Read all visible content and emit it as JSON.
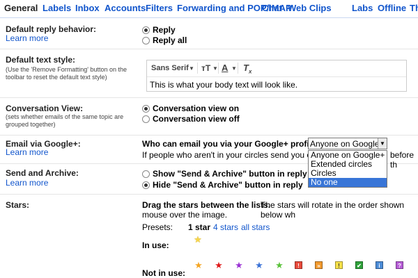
{
  "tabs": [
    "General",
    "Labels",
    "Inbox",
    "Accounts",
    "Filters",
    "Forwarding and POP/IMAP",
    "Chat",
    "Web Clips",
    "Labs",
    "Offline",
    "Th"
  ],
  "reply": {
    "label": "Default reply behavior:",
    "learn_more": "Learn more",
    "options": [
      "Reply",
      "Reply all"
    ],
    "selected": "Reply"
  },
  "text_style": {
    "label": "Default text style:",
    "hint": "(Use the 'Remove Formatting' button on the toolbar to reset the default text style)",
    "font": "Sans Serif",
    "size_icon": "text-size-icon",
    "color_icon": "text-color-icon",
    "remove_icon": "remove-formatting-icon",
    "sample": "This is what your body text will look like."
  },
  "conversation": {
    "label": "Conversation View:",
    "hint": "(sets whether emails of the same topic are grouped together)",
    "options": [
      "Conversation view on",
      "Conversation view off"
    ],
    "selected": "Conversation view on"
  },
  "google_plus": {
    "label": "Email via Google+:",
    "learn_more": "Learn more",
    "question": "Who can email you via your Google+ profile?",
    "selected": "Anyone on Google+",
    "options": [
      "Anyone on Google+",
      "Extended circles",
      "Circles",
      "No one"
    ],
    "highlighted": "No one",
    "note_start": "If people who aren't in your circles send you email t",
    "note_end": "before th"
  },
  "send_archive": {
    "label": "Send and Archive:",
    "learn_more": "Learn more",
    "options": [
      "Show \"Send & Archive\" button in reply",
      "Hide \"Send & Archive\" button in reply"
    ],
    "selected": "Hide \"Send & Archive\" button in reply"
  },
  "stars": {
    "label": "Stars:",
    "instructions_bold": "Drag the stars between the lists.",
    "instructions_rest": "The stars will rotate in the order shown below wh",
    "instructions_line2": "mouse over the image.",
    "presets_label": "Presets:",
    "presets": [
      "1 star",
      "4 stars",
      "all stars"
    ],
    "active_preset": "1 star",
    "in_use_label": "In use:",
    "not_in_use_label": "Not in use:",
    "in_use_colors": [
      "#f7d64a"
    ],
    "not_in_use": [
      {
        "icon": "orange-star-icon",
        "color": "#f5a623"
      },
      {
        "icon": "red-star-icon",
        "color": "#e01b1b"
      },
      {
        "icon": "purple-star-icon",
        "color": "#9b32d4"
      },
      {
        "icon": "blue-star-icon",
        "color": "#3b72d6"
      },
      {
        "icon": "green-star-icon",
        "color": "#5ac23a"
      },
      {
        "icon": "red-bang-icon",
        "color": "#e84a3b",
        "glyph": "!"
      },
      {
        "icon": "orange-guillemet-icon",
        "color": "#f29a2e",
        "glyph": "»"
      },
      {
        "icon": "yellow-bang-icon",
        "color": "#f6e04a",
        "glyph": "!"
      },
      {
        "icon": "green-check-icon",
        "color": "#2fa13a",
        "glyph": "✔"
      },
      {
        "icon": "blue-info-icon",
        "color": "#4b8bd6",
        "glyph": "i"
      },
      {
        "icon": "purple-question-icon",
        "color": "#b65cd6",
        "glyph": "?"
      }
    ]
  }
}
